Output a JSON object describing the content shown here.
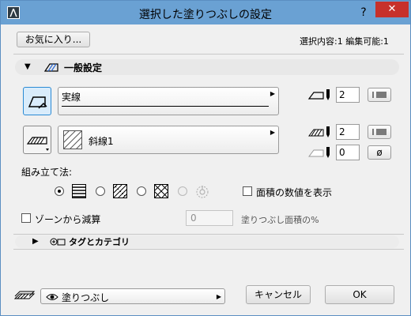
{
  "window": {
    "title": "選択した塗りつぶしの設定",
    "help_glyph": "?",
    "close_glyph": "✕"
  },
  "header": {
    "favorites_label": "お気に入り...",
    "selection_info": "選択内容:1 編集可能:1"
  },
  "general": {
    "title": "一般設定",
    "line_type_label": "実線",
    "fill_pattern_label": "斜線1",
    "pen_line": "2",
    "pen_fill": "2",
    "pen_background": "0",
    "assembly_label": "組み立て法:",
    "show_area_label": "面積の数値を表示",
    "zone_subtract_label": "ゾーンから減算",
    "area_percent_value": "0",
    "area_percent_label": "塗りつぶし面積の%",
    "selected_assembly": 0
  },
  "tags": {
    "title": "タグとカテゴリ"
  },
  "footer": {
    "layer_label": "塗りつぶし",
    "cancel_label": "キャンセル",
    "ok_label": "OK"
  },
  "colors": {
    "titlebar": "#6aa1d3",
    "close": "#c7312b",
    "active_border": "#2a8ad4"
  }
}
